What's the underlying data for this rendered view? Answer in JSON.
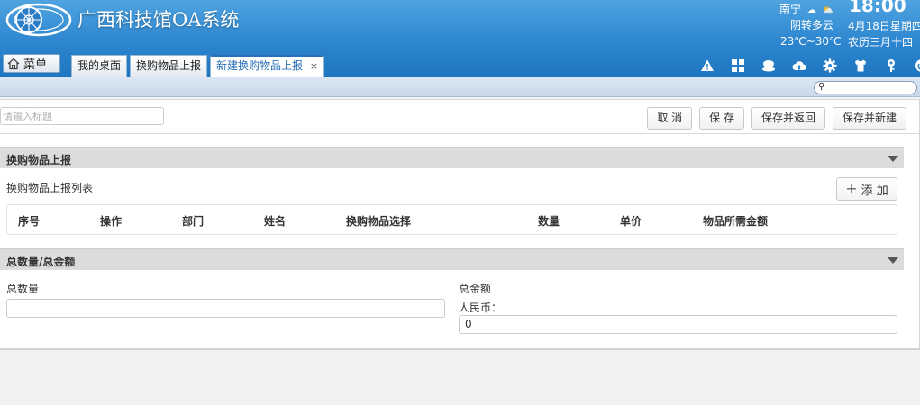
{
  "app": {
    "title": "广西科技馆OA系统",
    "menu_label": "菜单"
  },
  "weather": {
    "city": "南宁",
    "description": "阴转多云",
    "temperature": "23℃~30℃",
    "time": "18:00",
    "date": "4月18日星期四",
    "lunar": "农历三月十四"
  },
  "tabs": [
    {
      "label": "我的桌面",
      "active": false
    },
    {
      "label": "换购物品上报",
      "active": false
    },
    {
      "label": "新建换购物品上报",
      "active": true,
      "close": "×"
    }
  ],
  "toolbar_icons": [
    "triangle-alert-icon",
    "grid-apps-icon",
    "user-chat-icon",
    "cloud-upload-icon",
    "gear-icon",
    "shirt-skin-icon",
    "key-icon",
    "power-icon"
  ],
  "search": {
    "placeholder": ""
  },
  "form": {
    "title_placeholder": "请输入标题",
    "buttons": {
      "cancel": "取 消",
      "save": "保 存",
      "save_return": "保存并返回",
      "save_new": "保存并新建"
    }
  },
  "section1": {
    "title": "换购物品上报",
    "list_label": "换购物品上报列表",
    "add_label": "添 加",
    "columns": [
      "序号",
      "操作",
      "部门",
      "姓名",
      "换购物品选择",
      "数量",
      "单价",
      "物品所需金额"
    ]
  },
  "section2": {
    "title": "总数量/总金额",
    "total_qty_label": "总数量",
    "total_qty_value": "",
    "total_amount_label": "总金额",
    "currency_label": "人民币：",
    "total_amount_value": "0"
  }
}
